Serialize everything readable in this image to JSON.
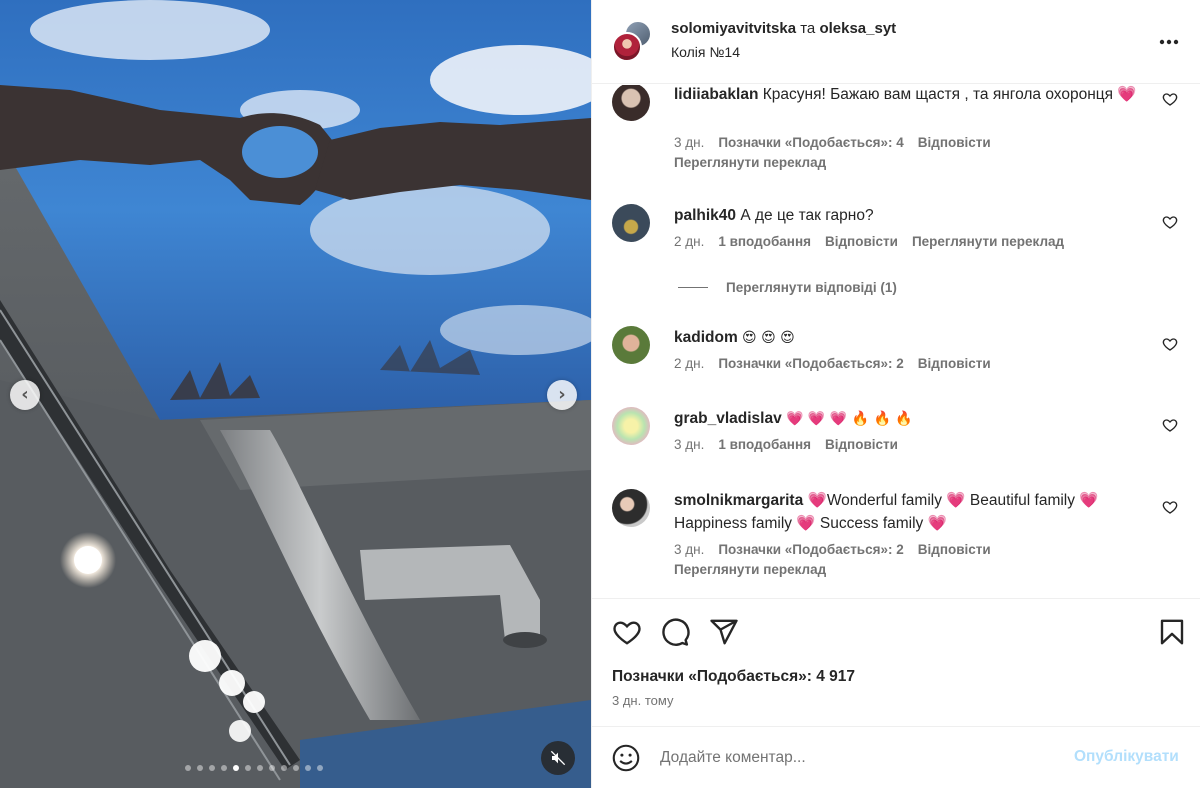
{
  "header": {
    "user1": "solomiyavitvitska",
    "joiner": "та",
    "user2": "oleksa_syt",
    "subtitle": "Колія №14"
  },
  "comments": [
    {
      "user": "lidiiabaklan",
      "text": "Красуня! Бажаю вам щастя , та янгола охоронця 💗",
      "time": "3 дн.",
      "likes": "Позначки «Подобається»: 4",
      "reply": "Відповісти",
      "translate": "Переглянути переклад"
    },
    {
      "user": "palhik40",
      "text": "А де це так гарно?",
      "time": "2 дн.",
      "likes": "1 вподобання",
      "reply": "Відповісти",
      "translate": "Переглянути переклад",
      "view_replies": "Переглянути відповіді (1)"
    },
    {
      "user": "kadidom",
      "text": "😍 😍 😍",
      "time": "2 дн.",
      "likes": "Позначки «Подобається»: 2",
      "reply": "Відповісти"
    },
    {
      "user": "grab_vladislav",
      "text": "💗 💗 💗 🔥 🔥 🔥",
      "time": "3 дн.",
      "likes": "1 вподобання",
      "reply": "Відповісти"
    },
    {
      "user": "smolnikmargarita",
      "text": "💗Wonderful family 💗 Beautiful family 💗 Happiness family 💗 Success family 💗",
      "time": "3 дн.",
      "likes": "Позначки «Подобається»: 2",
      "reply": "Відповісти",
      "translate": "Переглянути переклад"
    }
  ],
  "post": {
    "likes_label": "Позначки «Подобається»: 4 917",
    "time_ago": "3 дн. тому"
  },
  "composer": {
    "placeholder": "Додайте коментар...",
    "publish": "Опублікувати"
  },
  "carousel": {
    "slide_count": 12,
    "active_index": 4
  },
  "colors": {
    "accent_disabled": "#b2dffc",
    "secondary_text": "#737373",
    "primary_text": "#262626"
  }
}
